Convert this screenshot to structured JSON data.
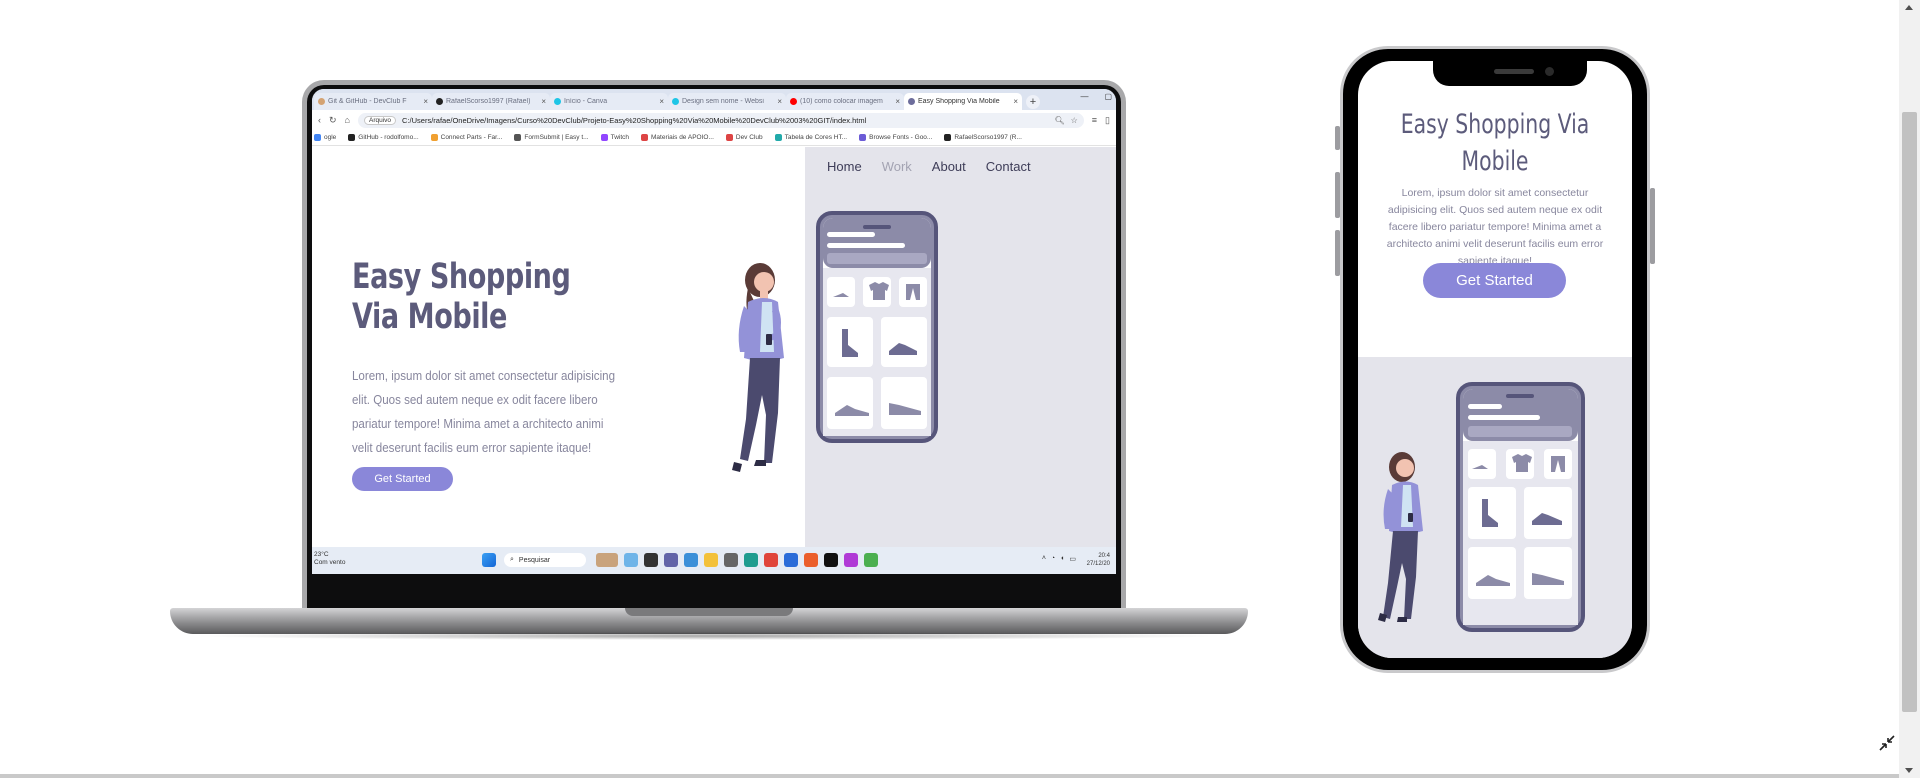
{
  "browser": {
    "tabs": [
      {
        "title": "Git & GitHub - DevClub F",
        "color": "#d4a373",
        "active": false
      },
      {
        "title": "RafaelScorso1997 (Rafael)",
        "color": "#222222",
        "active": false
      },
      {
        "title": "Início - Canva",
        "color": "#1ec5e6",
        "active": false
      },
      {
        "title": "Design sem nome - Websi",
        "color": "#1ec5e6",
        "active": false
      },
      {
        "title": "(10) como colocar imagem",
        "color": "#ff0000",
        "active": false
      },
      {
        "title": "Easy Shopping Via Mobile",
        "color": "#6d6d9b",
        "active": true
      }
    ],
    "new_tab": "+",
    "address": {
      "chip": "Arquivo",
      "url": "C:/Users/rafae/OneDrive/Imagens/Curso%20DevClub/Projeto-Easy%20Shopping%20Via%20Mobile%20DevClub%2003%20GIT/index.html"
    },
    "bookmarks": [
      {
        "label": "ogle",
        "color": "#4285f4"
      },
      {
        "label": "GitHub - rodolfomo...",
        "color": "#222222"
      },
      {
        "label": "Connect Parts - Far...",
        "color": "#f0a030"
      },
      {
        "label": "FormSubmit | Easy t...",
        "color": "#555555"
      },
      {
        "label": "Twitch",
        "color": "#9146ff"
      },
      {
        "label": "Materiais de APOIO...",
        "color": "#d44"
      },
      {
        "label": "Dev Club",
        "color": "#d44"
      },
      {
        "label": "Tabela de Cores HT...",
        "color": "#2aa"
      },
      {
        "label": "Browse Fonts - Goo...",
        "color": "#6b5bd6"
      },
      {
        "label": "RafaelScorso1997 (R...",
        "color": "#222222"
      }
    ]
  },
  "site": {
    "nav": [
      {
        "label": "Home",
        "dim": false
      },
      {
        "label": "Work",
        "dim": true
      },
      {
        "label": "About",
        "dim": false
      },
      {
        "label": "Contact",
        "dim": false
      }
    ],
    "title_line1": "Easy Shopping",
    "title_line2": "Via Mobile",
    "text": "Lorem, ipsum dolor sit amet consectetur adipisicing elit. Quos sed autem neque ex odit facere libero pariatur tempore! Minima amet a architecto animi velit deserunt facilis eum error sapiente itaque!",
    "button": "Get Started",
    "accent": "#8a87d9",
    "heading_color": "#5c5b7b",
    "panel_color": "#e4e4eb"
  },
  "taskbar": {
    "weather_temp": "23°C",
    "weather_desc": "Com vento",
    "search_placeholder": "Pesquisar",
    "time": "20:4",
    "date": "27/12/20"
  },
  "phone": {
    "title": "Easy Shopping Via Mobile",
    "text": "Lorem, ipsum dolor sit amet consectetur adipisicing elit. Quos sed autem neque ex odit facere libero pariatur tempore! Minima amet a architecto animi velit deserunt facilis eum error sapiente itaque!",
    "button": "Get Started"
  }
}
